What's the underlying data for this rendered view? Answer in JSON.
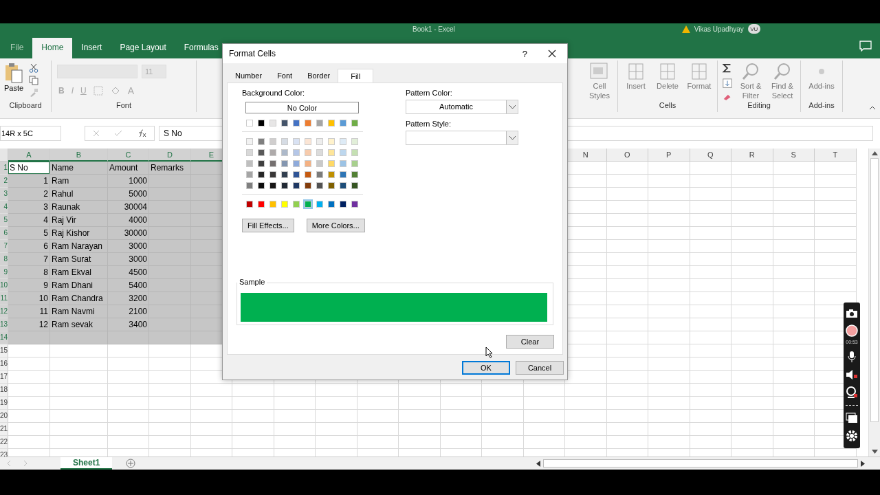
{
  "title_bar": {
    "title": "Book1 - Excel",
    "user": "Vikas Upadhyay",
    "avatar": "VU"
  },
  "ribbon_tabs": [
    {
      "label": "File",
      "selected": false
    },
    {
      "label": "Home",
      "selected": true
    },
    {
      "label": "Insert",
      "selected": false
    },
    {
      "label": "Page Layout",
      "selected": false
    },
    {
      "label": "Formulas",
      "selected": false
    }
  ],
  "ribbon": {
    "clipboard": {
      "paste": "Paste",
      "label": "Clipboard"
    },
    "font": {
      "size": "11",
      "bold": "B",
      "italic": "I",
      "underline": "U",
      "font_color": "A",
      "label": "Font"
    },
    "cell_styles": "Cell Styles",
    "cells": {
      "buttons": [
        "Insert",
        "Delete",
        "Format"
      ],
      "label": "Cells"
    },
    "editing": {
      "buttons": [
        "Sort & Filter",
        "Find & Select"
      ],
      "label": "Editing"
    },
    "addins": {
      "button": "Add-ins",
      "label": "Add-ins"
    }
  },
  "formula_bar": {
    "name_box": "14R x 5C",
    "value": "S No"
  },
  "sheet": {
    "columns_left": [
      {
        "letter": "A",
        "selected": true
      },
      {
        "letter": "B",
        "selected": true
      },
      {
        "letter": "C",
        "selected": true
      },
      {
        "letter": "D",
        "selected": true
      },
      {
        "letter": "E",
        "selected": true
      }
    ],
    "columns_right": [
      {
        "letter": "N",
        "selected": false
      },
      {
        "letter": "O",
        "selected": false
      },
      {
        "letter": "P",
        "selected": false
      },
      {
        "letter": "Q",
        "selected": false
      },
      {
        "letter": "R",
        "selected": false
      },
      {
        "letter": "S",
        "selected": false
      },
      {
        "letter": "T",
        "selected": false
      }
    ],
    "rows": [
      {
        "n": "1",
        "selected": true,
        "active": true,
        "cells": [
          {
            "t": "S No",
            "kind": "text"
          },
          {
            "t": "Name",
            "kind": "text"
          },
          {
            "t": "Amount",
            "kind": "text"
          },
          {
            "t": "Remarks",
            "kind": "text"
          }
        ]
      },
      {
        "n": "2",
        "selected": true,
        "active": false,
        "cells": [
          {
            "t": "1",
            "kind": "number"
          },
          {
            "t": "Ram",
            "kind": "text"
          },
          {
            "t": "1000",
            "kind": "number"
          }
        ]
      },
      {
        "n": "3",
        "selected": true,
        "active": false,
        "cells": [
          {
            "t": "2",
            "kind": "number"
          },
          {
            "t": "Rahul",
            "kind": "text"
          },
          {
            "t": "5000",
            "kind": "number"
          }
        ]
      },
      {
        "n": "4",
        "selected": true,
        "active": false,
        "cells": [
          {
            "t": "3",
            "kind": "number"
          },
          {
            "t": "Raunak",
            "kind": "text"
          },
          {
            "t": "30004",
            "kind": "number"
          }
        ]
      },
      {
        "n": "5",
        "selected": true,
        "active": false,
        "cells": [
          {
            "t": "4",
            "kind": "number"
          },
          {
            "t": "Raj Vir",
            "kind": "text"
          },
          {
            "t": "4000",
            "kind": "number"
          }
        ]
      },
      {
        "n": "6",
        "selected": true,
        "active": false,
        "cells": [
          {
            "t": "5",
            "kind": "number"
          },
          {
            "t": "Raj Kishor",
            "kind": "text"
          },
          {
            "t": "30000",
            "kind": "number"
          }
        ]
      },
      {
        "n": "7",
        "selected": true,
        "active": false,
        "cells": [
          {
            "t": "6",
            "kind": "number"
          },
          {
            "t": "Ram Narayan",
            "kind": "text"
          },
          {
            "t": "3000",
            "kind": "number"
          }
        ]
      },
      {
        "n": "8",
        "selected": true,
        "active": false,
        "cells": [
          {
            "t": "7",
            "kind": "number"
          },
          {
            "t": "Ram Surat",
            "kind": "text"
          },
          {
            "t": "3000",
            "kind": "number"
          }
        ]
      },
      {
        "n": "9",
        "selected": true,
        "active": false,
        "cells": [
          {
            "t": "8",
            "kind": "number"
          },
          {
            "t": "Ram Ekval",
            "kind": "text"
          },
          {
            "t": "4500",
            "kind": "number"
          }
        ]
      },
      {
        "n": "10",
        "selected": true,
        "active": false,
        "cells": [
          {
            "t": "9",
            "kind": "number"
          },
          {
            "t": "Ram Dhani",
            "kind": "text"
          },
          {
            "t": "5400",
            "kind": "number"
          }
        ]
      },
      {
        "n": "11",
        "selected": true,
        "active": false,
        "cells": [
          {
            "t": "10",
            "kind": "number"
          },
          {
            "t": "Ram Chandra",
            "kind": "text"
          },
          {
            "t": "3200",
            "kind": "number"
          }
        ]
      },
      {
        "n": "12",
        "selected": true,
        "active": false,
        "cells": [
          {
            "t": "11",
            "kind": "number"
          },
          {
            "t": "Ram Navmi",
            "kind": "text"
          },
          {
            "t": "2100",
            "kind": "number"
          }
        ]
      },
      {
        "n": "13",
        "selected": true,
        "active": false,
        "cells": [
          {
            "t": "12",
            "kind": "number"
          },
          {
            "t": "Ram sevak",
            "kind": "text"
          },
          {
            "t": "3400",
            "kind": "number"
          }
        ]
      },
      {
        "n": "14",
        "selected": true,
        "active": false
      },
      {
        "n": "15",
        "selected": false,
        "active": false
      },
      {
        "n": "16",
        "selected": false,
        "active": false
      },
      {
        "n": "17",
        "selected": false,
        "active": false
      },
      {
        "n": "18",
        "selected": false,
        "active": false
      },
      {
        "n": "19",
        "selected": false,
        "active": false
      },
      {
        "n": "20",
        "selected": false,
        "active": false
      },
      {
        "n": "21",
        "selected": false,
        "active": false
      },
      {
        "n": "22",
        "selected": false,
        "active": false
      },
      {
        "n": "23",
        "selected": false,
        "active": false
      }
    ],
    "sheet_tabs": [
      {
        "label": "Sheet1",
        "selected": true
      }
    ]
  },
  "dialog": {
    "title": "Format Cells",
    "help": "?",
    "tabs": [
      {
        "label": "Number",
        "selected": false
      },
      {
        "label": "Font",
        "selected": false
      },
      {
        "label": "Border",
        "selected": false
      },
      {
        "label": "Fill",
        "selected": true
      }
    ],
    "background_color_label": "Background Color:",
    "no_color": "No Color",
    "palette": [
      {
        "kind": "theme",
        "swatches": [
          {
            "color": "#ffffff",
            "selected": false
          },
          {
            "color": "#000000",
            "selected": false
          },
          {
            "color": "#e7e6e6",
            "selected": false
          },
          {
            "color": "#44546a",
            "selected": false
          },
          {
            "color": "#4472c4",
            "selected": false
          },
          {
            "color": "#ed7d31",
            "selected": false
          },
          {
            "color": "#a5a5a5",
            "selected": false
          },
          {
            "color": "#ffc000",
            "selected": false
          },
          {
            "color": "#5b9bd5",
            "selected": false
          },
          {
            "color": "#70ad47",
            "selected": false
          }
        ]
      },
      {
        "kind": "tint",
        "swatches": [
          {
            "color": "#f2f2f2",
            "selected": false
          },
          {
            "color": "#7f7f7f",
            "selected": false
          },
          {
            "color": "#d0cece",
            "selected": false
          },
          {
            "color": "#d6dce4",
            "selected": false
          },
          {
            "color": "#d9e2f3",
            "selected": false
          },
          {
            "color": "#fbe5d5",
            "selected": false
          },
          {
            "color": "#ededed",
            "selected": false
          },
          {
            "color": "#fff2cc",
            "selected": false
          },
          {
            "color": "#deebf6",
            "selected": false
          },
          {
            "color": "#e2efd9",
            "selected": false
          }
        ]
      },
      {
        "kind": "tint",
        "swatches": [
          {
            "color": "#d8d8d8",
            "selected": false
          },
          {
            "color": "#595959",
            "selected": false
          },
          {
            "color": "#aeaaaa",
            "selected": false
          },
          {
            "color": "#adb9ca",
            "selected": false
          },
          {
            "color": "#b4c6e7",
            "selected": false
          },
          {
            "color": "#f7cbac",
            "selected": false
          },
          {
            "color": "#dbdbdb",
            "selected": false
          },
          {
            "color": "#fee599",
            "selected": false
          },
          {
            "color": "#bdd7ee",
            "selected": false
          },
          {
            "color": "#c5e0b3",
            "selected": false
          }
        ]
      },
      {
        "kind": "tint",
        "swatches": [
          {
            "color": "#bfbfbf",
            "selected": false
          },
          {
            "color": "#3f3f3f",
            "selected": false
          },
          {
            "color": "#757070",
            "selected": false
          },
          {
            "color": "#8496b0",
            "selected": false
          },
          {
            "color": "#8eaadb",
            "selected": false
          },
          {
            "color": "#f4b183",
            "selected": false
          },
          {
            "color": "#c9c9c9",
            "selected": false
          },
          {
            "color": "#ffd965",
            "selected": false
          },
          {
            "color": "#9cc3e5",
            "selected": false
          },
          {
            "color": "#a8d08d",
            "selected": false
          }
        ]
      },
      {
        "kind": "tint",
        "swatches": [
          {
            "color": "#a5a5a5",
            "selected": false
          },
          {
            "color": "#262626",
            "selected": false
          },
          {
            "color": "#3a3838",
            "selected": false
          },
          {
            "color": "#323f4f",
            "selected": false
          },
          {
            "color": "#2f5496",
            "selected": false
          },
          {
            "color": "#c55a11",
            "selected": false
          },
          {
            "color": "#7b7b7b",
            "selected": false
          },
          {
            "color": "#bf9000",
            "selected": false
          },
          {
            "color": "#2e75b5",
            "selected": false
          },
          {
            "color": "#538135",
            "selected": false
          }
        ]
      },
      {
        "kind": "tint",
        "swatches": [
          {
            "color": "#7f7f7f",
            "selected": false
          },
          {
            "color": "#0c0c0c",
            "selected": false
          },
          {
            "color": "#171616",
            "selected": false
          },
          {
            "color": "#222a35",
            "selected": false
          },
          {
            "color": "#1f3864",
            "selected": false
          },
          {
            "color": "#833c0b",
            "selected": false
          },
          {
            "color": "#525252",
            "selected": false
          },
          {
            "color": "#7f6000",
            "selected": false
          },
          {
            "color": "#1e4e79",
            "selected": false
          },
          {
            "color": "#375623",
            "selected": false
          }
        ]
      },
      {
        "kind": "standard",
        "swatches": [
          {
            "color": "#c00000",
            "selected": false
          },
          {
            "color": "#ff0000",
            "selected": false
          },
          {
            "color": "#ffc000",
            "selected": false
          },
          {
            "color": "#ffff00",
            "selected": false
          },
          {
            "color": "#92d050",
            "selected": false
          },
          {
            "color": "#00b050",
            "selected": true
          },
          {
            "color": "#00b0f0",
            "selected": false
          },
          {
            "color": "#0070c0",
            "selected": false
          },
          {
            "color": "#002060",
            "selected": false
          },
          {
            "color": "#7030a0",
            "selected": false
          }
        ]
      }
    ],
    "fill_effects": "Fill Effects...",
    "more_colors": "More Colors...",
    "pattern_color_label": "Pattern Color:",
    "pattern_color": "Automatic",
    "pattern_style_label": "Pattern Style:",
    "sample_label": "Sample",
    "clear": "Clear",
    "ok": "OK",
    "cancel": "Cancel"
  },
  "recorder": {
    "time": "00:53"
  }
}
